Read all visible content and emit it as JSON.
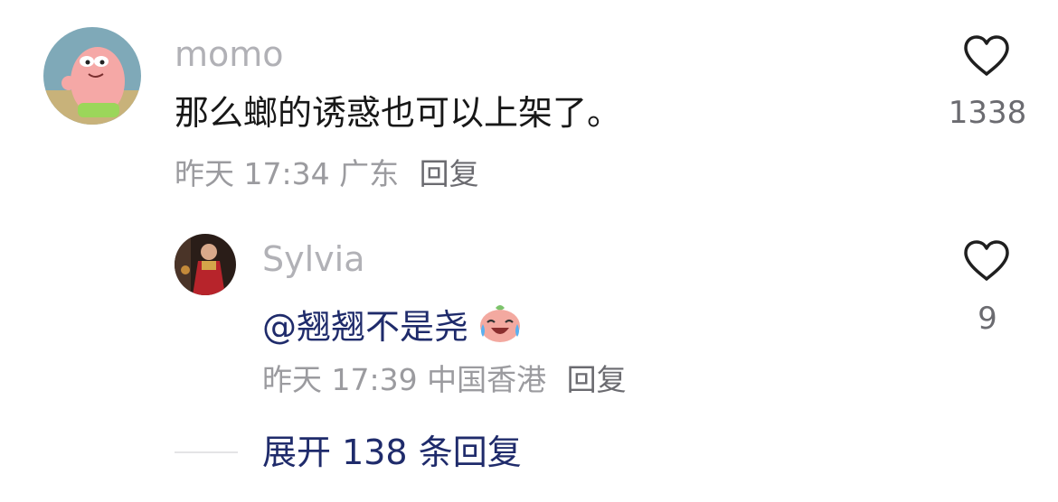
{
  "comment": {
    "username": "momo",
    "text": "那么螂的诱惑也可以上架了。",
    "time": "昨天 17:34",
    "location": "广东",
    "reply_label": "回复",
    "likes": "1338"
  },
  "reply": {
    "username": "Sylvia",
    "text": "@翘翘不是尧",
    "time": "昨天 17:39",
    "location": "中国香港",
    "reply_label": "回复",
    "likes": "9"
  },
  "expand_label": "展开 138 条回复",
  "colors": {
    "username": "#b1b1b6",
    "link_blue": "#1f2b6b",
    "meta_gray": "#9b9b9f"
  }
}
